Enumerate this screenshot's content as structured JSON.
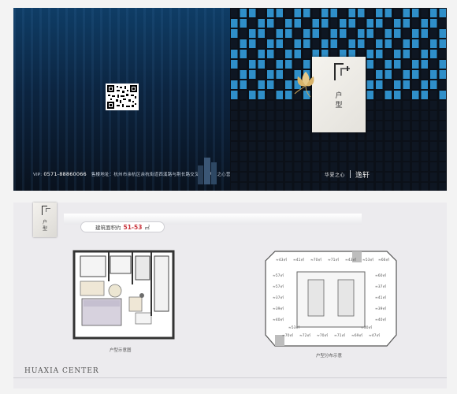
{
  "cover": {
    "contact_label": "VIP:",
    "phone": "0571-88860066",
    "address": "售楼地址：杭州市余杭区余杭街道西溪路与荆长路交叉口（华夏之心营销中心）",
    "brand_en_cn": "华夏之心",
    "brand_name": "逸轩",
    "card_title_line1": "户",
    "card_title_line2": "型"
  },
  "plan_page": {
    "badge_line1": "户",
    "badge_line2": "型",
    "area_label": "建筑面积约",
    "area_value": "51-53",
    "area_unit": "㎡",
    "unit_plan_caption": "户型示意图",
    "floor_plan_caption": "户型分布示意",
    "footer_logo": "HUAXIA CENTER"
  },
  "floor_units": [
    "43",
    "41",
    "70",
    "71",
    "43",
    "53",
    "66",
    "57",
    "60",
    "57",
    "37",
    "37",
    "41",
    "39",
    "39",
    "40",
    "40",
    "70",
    "72",
    "70",
    "71",
    "69",
    "47",
    "53",
    "30"
  ],
  "colors": {
    "cover_bg": "#0b1220",
    "tile_blue": "#2f8fc9",
    "tile_dark": "#0e1622",
    "accent_red": "#c9323b"
  }
}
